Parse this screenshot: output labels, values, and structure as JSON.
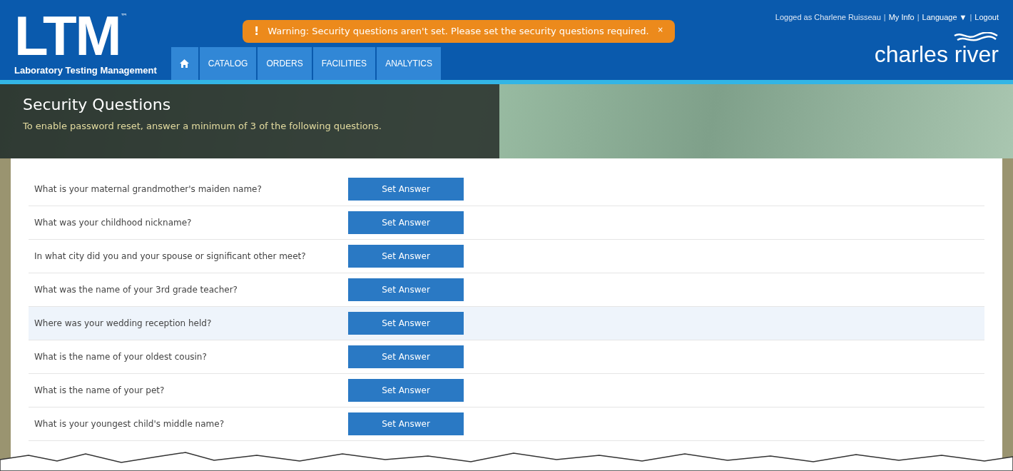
{
  "header": {
    "logo": "LTM",
    "logo_mark": "™",
    "logo_subtitle": "Laboratory Testing Management",
    "brand": "charles river",
    "user_links": [
      {
        "kind": "text",
        "label": "Logged as Charlene Ruisseau"
      },
      {
        "kind": "separator",
        "label": "|"
      },
      {
        "kind": "link",
        "label": "My Info"
      },
      {
        "kind": "separator",
        "label": "|"
      },
      {
        "kind": "link",
        "label": "Language ▼"
      },
      {
        "kind": "separator",
        "label": "|"
      },
      {
        "kind": "link",
        "label": "Logout"
      }
    ],
    "nav": [
      {
        "kind": "icon"
      },
      {
        "kind": "text",
        "label": "CATALOG"
      },
      {
        "kind": "text",
        "label": "ORDERS"
      },
      {
        "kind": "text",
        "label": "FACILITIES"
      },
      {
        "kind": "text",
        "label": "ANALYTICS"
      }
    ]
  },
  "alert": {
    "icon": "!",
    "message": "Warning: Security questions aren't set. Please set the security questions required.",
    "close": "×"
  },
  "page": {
    "title": "Security Questions",
    "subtitle": "To enable password reset, answer a minimum of 3 of the following questions."
  },
  "questions": [
    {
      "question": "What is your maternal grandmother's maiden name?",
      "button": "Set Answer",
      "highlighted": false
    },
    {
      "question": "What was your childhood nickname?",
      "button": "Set Answer",
      "highlighted": false
    },
    {
      "question": "In what city did you and your spouse or significant other meet?",
      "button": "Set Answer",
      "highlighted": false
    },
    {
      "question": "What was the name of your 3rd grade teacher?",
      "button": "Set Answer",
      "highlighted": false
    },
    {
      "question": "Where was your wedding reception held?",
      "button": "Set Answer",
      "highlighted": true
    },
    {
      "question": "What is the name of your oldest cousin?",
      "button": "Set Answer",
      "highlighted": false
    },
    {
      "question": "What is the name of your pet?",
      "button": "Set Answer",
      "highlighted": false
    },
    {
      "question": "What is your youngest child's middle name?",
      "button": "Set Answer",
      "highlighted": false
    }
  ]
}
